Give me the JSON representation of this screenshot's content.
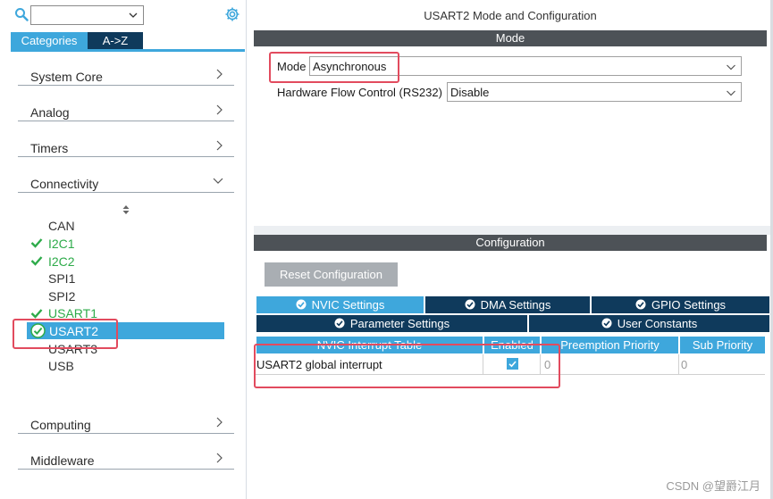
{
  "left_panel": {
    "search": {
      "value": "",
      "placeholder": ""
    },
    "tabs": {
      "categories": "Categories",
      "az": "A->Z"
    },
    "categories": [
      {
        "label": "System Core"
      },
      {
        "label": "Analog"
      },
      {
        "label": "Timers"
      },
      {
        "label": "Connectivity"
      }
    ],
    "peripherals": [
      {
        "label": "CAN"
      },
      {
        "label": "I2C1"
      },
      {
        "label": "I2C2"
      },
      {
        "label": "SPI1"
      },
      {
        "label": "SPI2"
      },
      {
        "label": "USART1"
      },
      {
        "label": "USART2"
      },
      {
        "label": "USART3"
      },
      {
        "label": "USB"
      }
    ],
    "bottom_categories": [
      {
        "label": "Computing"
      },
      {
        "label": "Middleware"
      }
    ]
  },
  "right_panel": {
    "title": "USART2 Mode and Configuration",
    "mode_band": "Mode",
    "mode": {
      "label": "Mode",
      "value": "Asynchronous"
    },
    "flow_control": {
      "label": "Hardware Flow Control (RS232)",
      "value": "Disable"
    },
    "config_band": "Configuration",
    "reset_button": "Reset Configuration",
    "settings_tabs": {
      "nvic": "NVIC Settings",
      "dma": "DMA Settings",
      "gpio": "GPIO Settings",
      "parameter": "Parameter Settings",
      "user_constants": "User Constants"
    },
    "table": {
      "headers": [
        "NVIC Interrupt Table",
        "Enabled",
        "Preemption Priority",
        "Sub Priority"
      ],
      "rows": [
        {
          "name": "USART2 global interrupt",
          "enabled": true,
          "preemption": "0",
          "sub": "0"
        }
      ]
    }
  },
  "watermark": "CSDN @望爵江月",
  "colors": {
    "accent": "#3ea7dc",
    "dark_navy": "#0f3a5c",
    "band_gray": "#4d5257",
    "check_green": "#2eab4a",
    "highlight_red": "#e24b5e"
  }
}
